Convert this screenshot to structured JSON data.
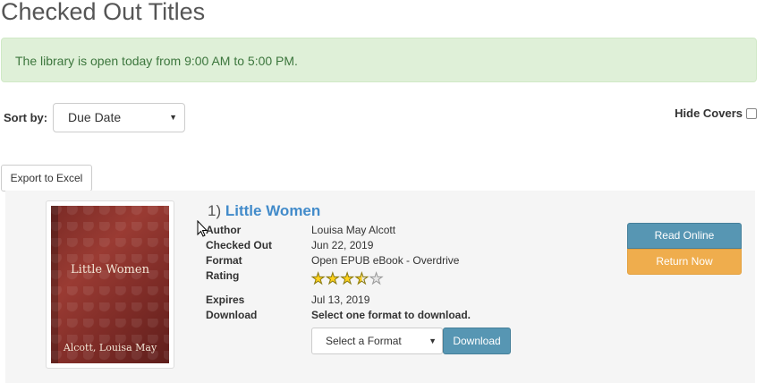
{
  "page": {
    "title": "Checked Out Titles"
  },
  "alert": {
    "message": "The library is open today from 9:00 AM to 5:00 PM."
  },
  "sort": {
    "label": "Sort by:",
    "selected": "Due Date"
  },
  "hide_covers": {
    "label": "Hide Covers",
    "checked": false
  },
  "export": {
    "label": "Export to Excel"
  },
  "item": {
    "number": "1)",
    "title": "Little Women",
    "cover": {
      "title": "Little Women",
      "author": "Alcott, Louisa May"
    },
    "fields": {
      "author_label": "Author",
      "author_value": "Louisa May Alcott",
      "checked_out_label": "Checked Out",
      "checked_out_value": "Jun 22, 2019",
      "format_label": "Format",
      "format_value": "Open EPUB eBook - Overdrive",
      "rating_label": "Rating",
      "rating_value": 3.5,
      "rating_max": 5,
      "expires_label": "Expires",
      "expires_value": "Jul 13, 2019",
      "download_label": "Download",
      "download_value": "Select one format to download."
    },
    "format_select": {
      "selected": "Select a Format"
    },
    "download_button": "Download",
    "read_online_button": "Read Online",
    "return_now_button": "Return Now"
  },
  "colors": {
    "alert_bg": "#dff0d8",
    "primary": "#5796b3",
    "warning": "#efad4d",
    "link": "#428bca"
  }
}
